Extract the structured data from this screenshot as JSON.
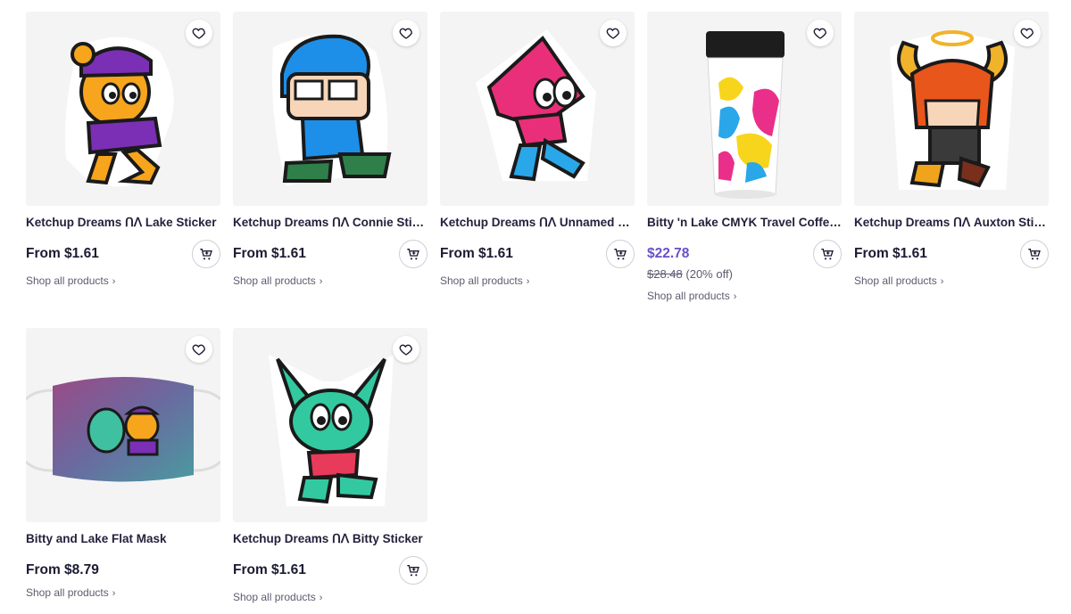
{
  "products": [
    {
      "title": "Ketchup Dreams ᑎᐱ Lake Sticker",
      "price": "From $1.61",
      "shop": "Shop all products"
    },
    {
      "title": "Ketchup Dreams ᑎᐱ Connie Sticker",
      "price": "From $1.61",
      "shop": "Shop all products"
    },
    {
      "title": "Ketchup Dreams ᑎᐱ Unnamed Fan Sticker",
      "price": "From $1.61",
      "shop": "Shop all products"
    },
    {
      "title": "Bitty 'n Lake CMYK Travel Coffee Mug",
      "price": "$22.78",
      "original_price": "$28.48",
      "discount": "(20% off)",
      "shop": "Shop all products"
    },
    {
      "title": "Ketchup Dreams ᑎᐱ Auxton Sticker",
      "price": "From $1.61",
      "shop": "Shop all products"
    },
    {
      "title": "Bitty and Lake Flat Mask",
      "price": "From $8.79",
      "shop": "Shop all products"
    },
    {
      "title": "Ketchup Dreams ᑎᐱ Bitty Sticker",
      "price": "From $1.61",
      "shop": "Shop all products"
    }
  ],
  "colors": {
    "sale_price": "#6a4fc9",
    "card_bg": "#f4f4f5",
    "text": "#1b1a33"
  },
  "icons": {
    "favorite": "heart-icon",
    "cart": "add-to-cart-icon",
    "chevron": "chevron-right-icon"
  }
}
